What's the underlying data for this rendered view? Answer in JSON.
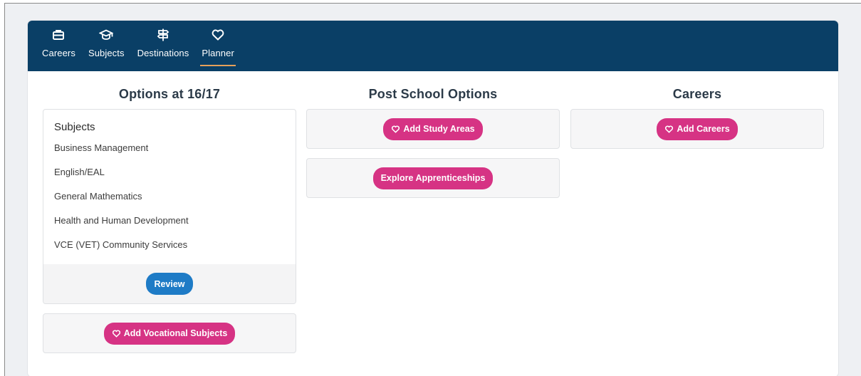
{
  "nav": {
    "items": [
      {
        "label": "Careers",
        "icon": "briefcase-icon"
      },
      {
        "label": "Subjects",
        "icon": "graduation-cap-icon"
      },
      {
        "label": "Destinations",
        "icon": "signpost-icon"
      },
      {
        "label": "Planner",
        "icon": "heart-icon",
        "active": true
      }
    ]
  },
  "columns": {
    "options": {
      "title": "Options at 16/17",
      "subjects_heading": "Subjects",
      "subjects": [
        "Business Management",
        "English/EAL",
        "General Mathematics",
        "Health and Human Development",
        "VCE (VET) Community Services"
      ],
      "review_label": "Review",
      "vocational_label": "Add Vocational Subjects"
    },
    "post_school": {
      "title": "Post School Options",
      "study_areas_label": "Add Study Areas",
      "apprenticeships_label": "Explore Apprenticeships"
    },
    "careers": {
      "title": "Careers",
      "add_careers_label": "Add Careers"
    }
  },
  "colors": {
    "nav_bg": "#0a3f66",
    "accent_pink": "#d63384",
    "accent_blue": "#1e7bc6",
    "active_underline": "#e6a05a"
  }
}
